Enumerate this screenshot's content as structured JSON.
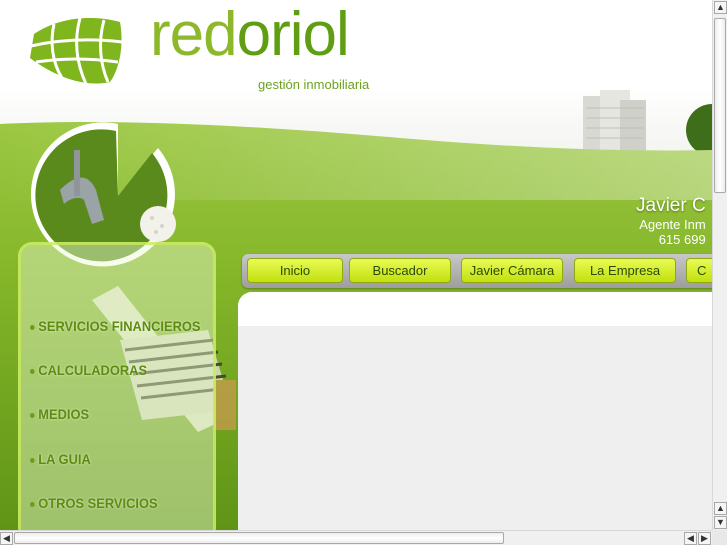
{
  "brand": {
    "name_part1": "red",
    "name_part2": "oriol",
    "tagline": "gestión inmobiliaria"
  },
  "agent": {
    "name": "Javier C",
    "role": "Agente Inm",
    "phone": "615 699"
  },
  "nav": {
    "items": [
      {
        "label": "Inicio"
      },
      {
        "label": "Buscador"
      },
      {
        "label": "Javier Cámara"
      },
      {
        "label": "La Empresa"
      },
      {
        "label": "C"
      }
    ]
  },
  "sidebar": {
    "items": [
      {
        "label": "SERVICIOS FINANCIEROS"
      },
      {
        "label": "CALCULADORAS"
      },
      {
        "label": "MEDIOS"
      },
      {
        "label": "LA GUIA"
      },
      {
        "label": "OTROS SERVICIOS"
      }
    ]
  },
  "scrollbars": {
    "up_arrow": "▲",
    "down_arrow": "▼",
    "left_arrow": "◀",
    "right_arrow": "▶"
  },
  "colors": {
    "brand_green": "#8cb82a",
    "nav_button": "#d8f020",
    "sidebar_text": "#5e8c0f",
    "grass": "#7fb21c"
  }
}
